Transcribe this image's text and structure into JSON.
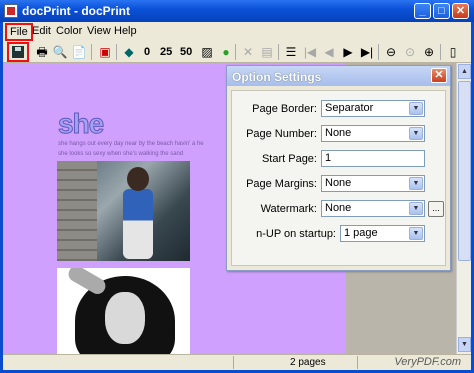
{
  "window": {
    "title": "docPrint - docPrint"
  },
  "title_controls": {
    "minimize": "_",
    "maximize": "□",
    "close": "✕"
  },
  "menu": {
    "items": [
      "File",
      "Edit",
      "Color",
      "View",
      "Help"
    ]
  },
  "toolbar": {
    "num_0": "0",
    "num_25": "25",
    "num_50": "50"
  },
  "document": {
    "heading": "she",
    "line1": "she hangs out every day near by the beach havin' a he",
    "line2": "she looks so sexy when she's walking the sand"
  },
  "dialog": {
    "title": "Option Settings",
    "close": "✕",
    "fields": {
      "page_border": {
        "label": "Page Border:",
        "value": "Separator"
      },
      "page_number": {
        "label": "Page Number:",
        "value": "None"
      },
      "start_page": {
        "label": "Start Page:",
        "value": "1"
      },
      "page_margins": {
        "label": "Page Margins:",
        "value": "None"
      },
      "watermark": {
        "label": "Watermark:",
        "value": "None",
        "browse": "..."
      },
      "n_up": {
        "label": "n-UP on startup:",
        "value": "1 page"
      }
    }
  },
  "status": {
    "pages": "2 pages",
    "brand": "VeryPDF.com"
  },
  "colors": {
    "document_bg": "#cfa0fd",
    "accent_highlight": "#e11111",
    "titlebar": "#0b52d9"
  }
}
